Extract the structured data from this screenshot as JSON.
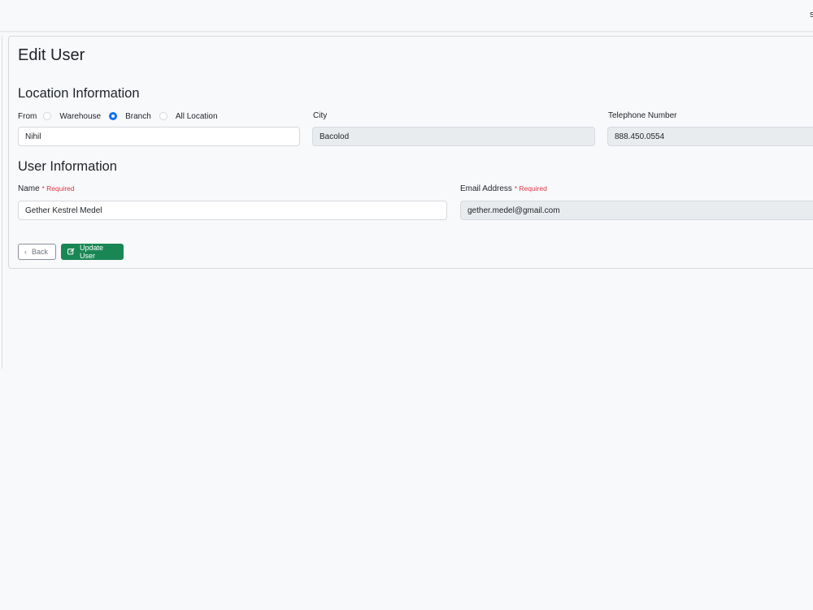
{
  "topbar": {
    "user_initial": "s"
  },
  "page": {
    "title": "Edit User"
  },
  "location": {
    "section_title": "Location Information",
    "from_label": "From",
    "options": [
      {
        "label": "Warehouse",
        "checked": false
      },
      {
        "label": "Branch",
        "checked": true
      },
      {
        "label": "All Location",
        "checked": false
      }
    ],
    "location_value": "Nihil",
    "city_label": "City",
    "city_value": "Bacolod",
    "phone_label": "Telephone Number",
    "phone_value": "888.450.0554"
  },
  "user": {
    "section_title": "User Information",
    "name_label": "Name",
    "name_required": "* Required",
    "name_value": "Gether Kestrel Medel",
    "email_label": "Email Address",
    "email_required": "* Required",
    "email_value": "gether.medel@gmail.com"
  },
  "actions": {
    "back_label": "Back",
    "update_label": "Update User"
  },
  "colors": {
    "accent": "#0d6efd",
    "success": "#198754",
    "required": "#dc3545"
  }
}
